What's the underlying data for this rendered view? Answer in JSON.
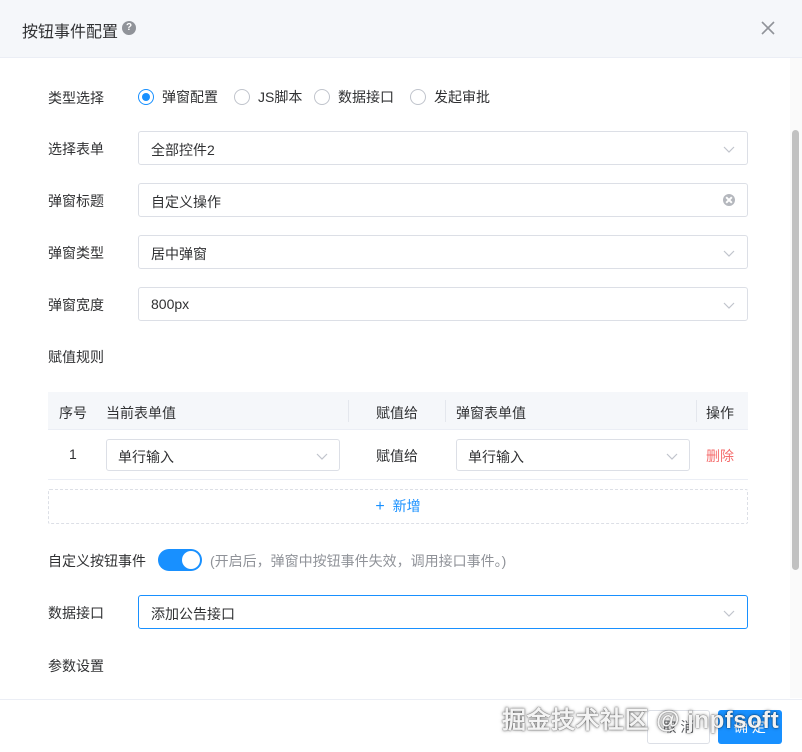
{
  "dialog": {
    "title": "按钮事件配置",
    "help_glyph": "?"
  },
  "form": {
    "type_label": "类型选择",
    "type_options": [
      {
        "label": "弹窗配置",
        "checked": true
      },
      {
        "label": "JS脚本",
        "checked": false
      },
      {
        "label": "数据接口",
        "checked": false
      },
      {
        "label": "发起审批",
        "checked": false
      }
    ],
    "form_label": "选择表单",
    "form_value": "全部控件2",
    "popup_title_label": "弹窗标题",
    "popup_title_value": "自定义操作",
    "popup_type_label": "弹窗类型",
    "popup_type_value": "居中弹窗",
    "popup_width_label": "弹窗宽度",
    "popup_width_value": "800px",
    "assign_rules_label": "赋值规则",
    "custom_button_label": "自定义按钮事件",
    "custom_button_enabled": true,
    "custom_button_hint": "(开启后，弹窗中按钮事件失效，调用接口事件。)",
    "data_interface_label": "数据接口",
    "data_interface_value": "添加公告接口",
    "param_settings_label": "参数设置"
  },
  "rules_table": {
    "headers": {
      "index": "序号",
      "current_value": "当前表单值",
      "assign_to": "赋值给",
      "popup_value": "弹窗表单值",
      "action": "操作"
    },
    "rows": [
      {
        "index": "1",
        "current_value": "单行输入",
        "assign_to": "赋值给",
        "popup_value": "单行输入",
        "action": "删除"
      }
    ],
    "add_label": "新增",
    "add_glyph": "+"
  },
  "footer": {
    "cancel_label": "取 消",
    "ok_label": "确 定"
  },
  "watermark": "掘金技术社区 @ jnpfsoft",
  "colors": {
    "primary": "#1890ff",
    "danger": "#f56c6c",
    "border": "#dcdfe6",
    "header_bg": "#f5f7fa"
  }
}
